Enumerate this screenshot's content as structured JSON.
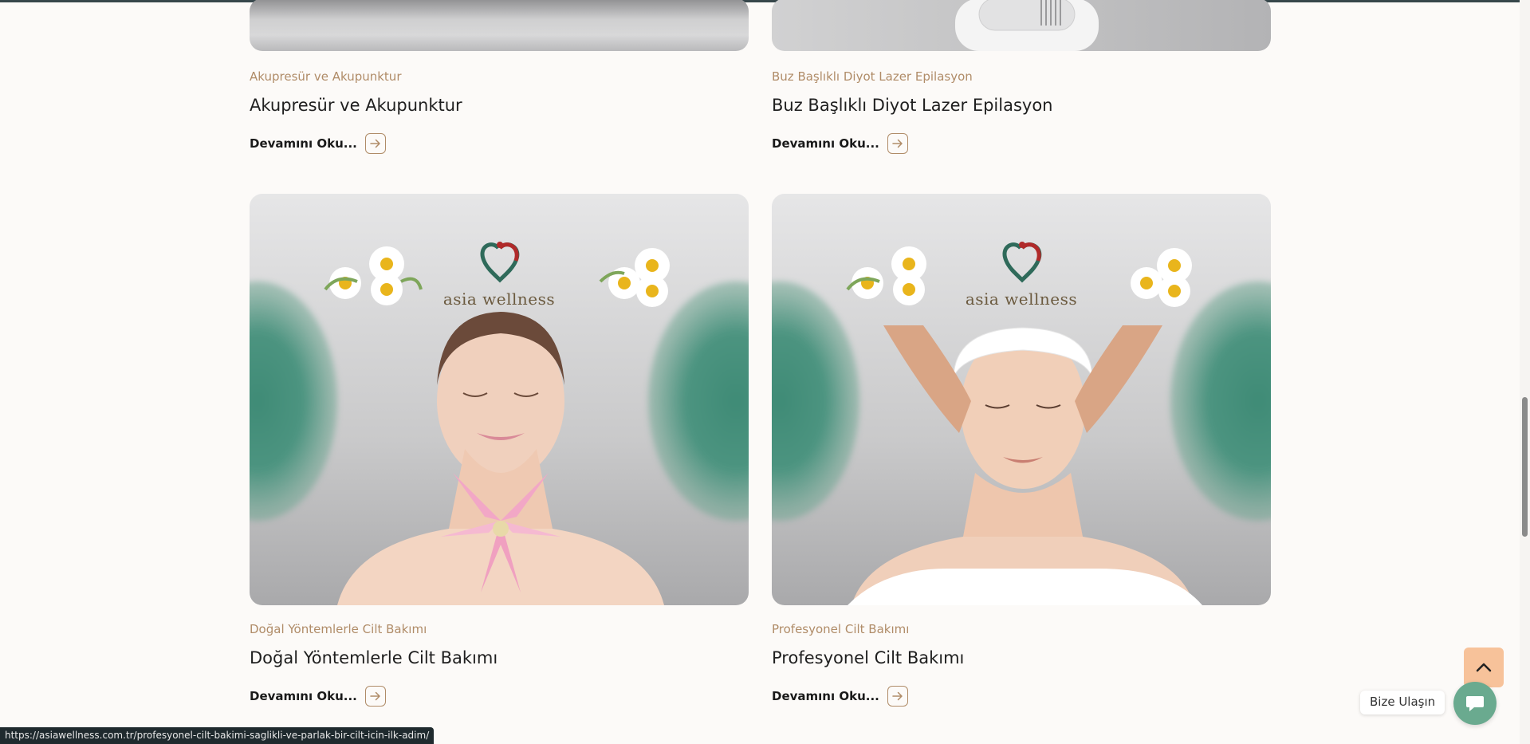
{
  "posts": [
    {
      "category": "Akupresür ve Akupunktur",
      "title": "Akupresür ve Akupunktur",
      "read_more": "Devamını Oku..."
    },
    {
      "category": "Buz Başlıklı Diyot Lazer Epilasyon",
      "title": "Buz Başlıklı Diyot Lazer Epilasyon",
      "read_more": "Devamını Oku..."
    },
    {
      "category": "Doğal Yöntemlerle Cilt Bakımı",
      "title": "Doğal Yöntemlerle Cilt Bakımı",
      "read_more": "Devamını Oku...",
      "image_logo_text": "asia wellness"
    },
    {
      "category": "Profesyonel Cilt Bakımı",
      "title": "Profesyonel Cilt Bakımı",
      "read_more": "Devamını Oku...",
      "image_logo_text": "asia wellness"
    }
  ],
  "floating": {
    "contact_label": "Bize Ulaşın",
    "back_to_top_icon": "chevron-up-icon",
    "contact_icon": "chat-icon"
  },
  "status_bar": {
    "url": "https://asiawellness.com.tr/profesyonel-cilt-bakimi-saglikli-ve-parlak-bir-cilt-icin-ilk-adim/"
  },
  "colors": {
    "accent": "#b08c68",
    "contact_button": "#6aaa8f",
    "back_to_top": "#f7c29a",
    "background": "#fcfaf8"
  }
}
